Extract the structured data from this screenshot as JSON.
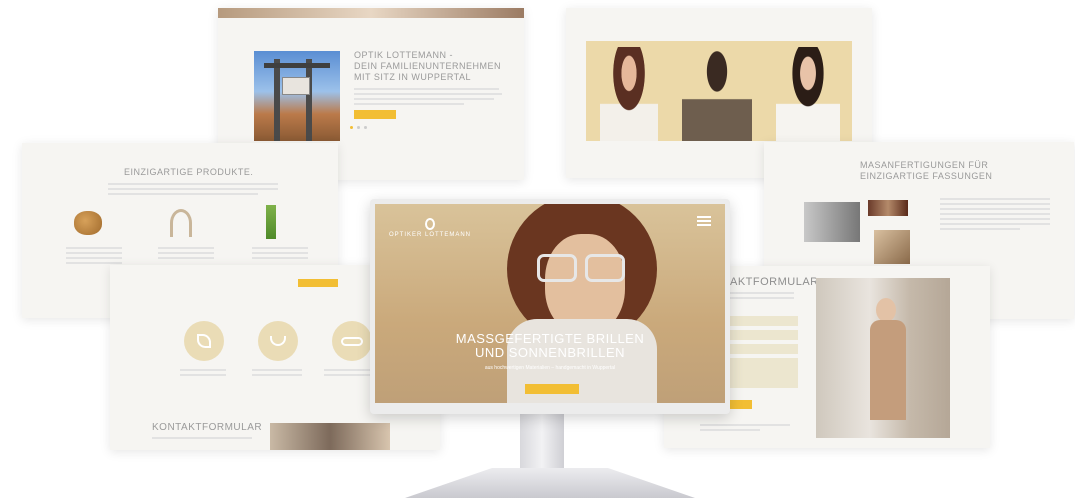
{
  "cards": {
    "top_left": {
      "heading_line1": "OPTIK LOTTEMANN -",
      "heading_line2": "DEIN FAMILIENUNTERNEHMEN",
      "heading_line3": "MIT SITZ IN WUPPERTAL"
    },
    "left": {
      "heading": "EINZIGARTIGE PRODUKTE."
    },
    "bottom_left": {
      "heading": "KONTAKTFORMULAR"
    },
    "right_mid": {
      "heading_line1": "MASANFERTIGUNGEN FÜR",
      "heading_line2": "EINZIGARTIGE FASSUNGEN"
    },
    "bottom_right": {
      "heading": "AKTFORMULAR"
    }
  },
  "monitor": {
    "logo_name": "OPTIKER LOTTEMANN",
    "hero_line1": "MASSGEFERTIGTE BRILLEN",
    "hero_line2": "UND SONNENBRILLEN",
    "hero_sub": "aus hochwertigen Materialien – handgemacht in Wuppertal"
  },
  "colors": {
    "accent": "#f2be34",
    "card_bg": "#f6f5f2",
    "heading": "#9a9a9a"
  }
}
